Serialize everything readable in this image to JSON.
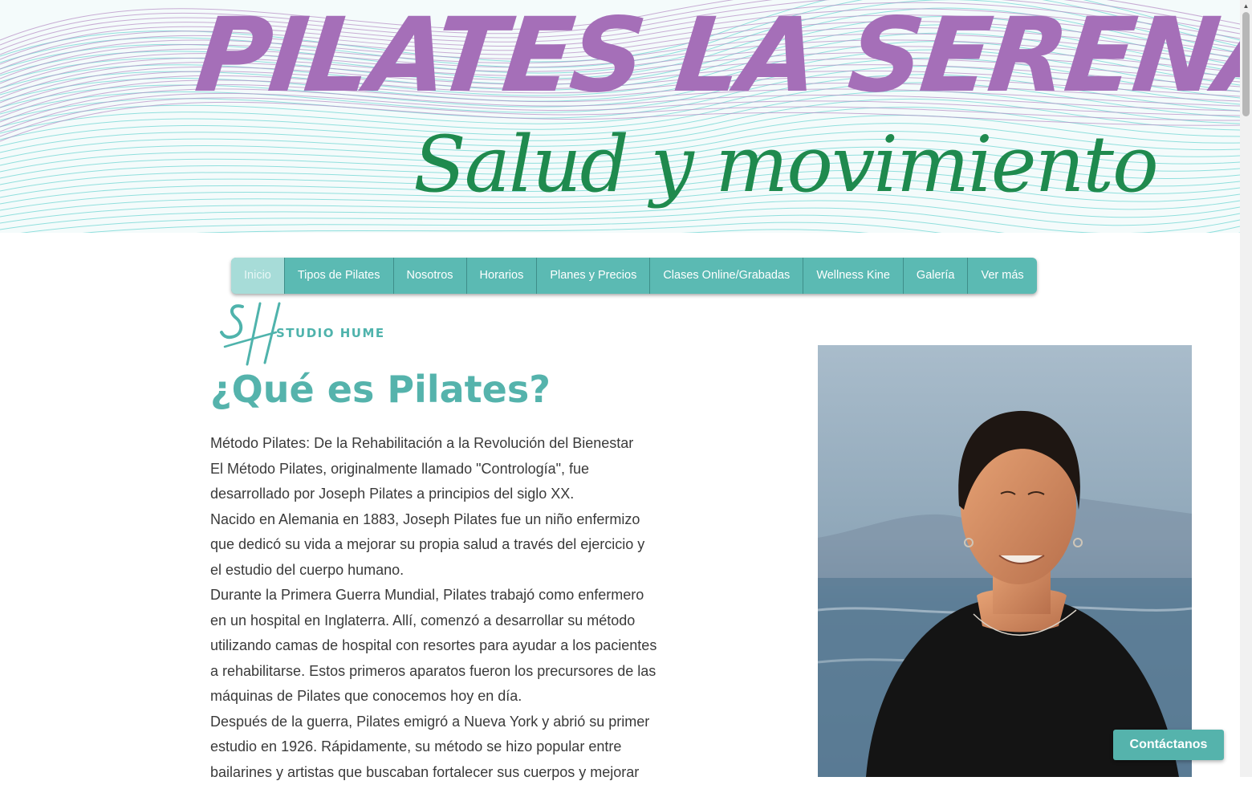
{
  "banner": {
    "title": "PILATES LA SERENA",
    "subtitle": "Salud y movimiento"
  },
  "nav": {
    "items": [
      {
        "label": "Inicio",
        "active": true
      },
      {
        "label": "Tipos de Pilates",
        "active": false
      },
      {
        "label": "Nosotros",
        "active": false
      },
      {
        "label": "Horarios",
        "active": false
      },
      {
        "label": "Planes y Precios",
        "active": false
      },
      {
        "label": "Clases Online/Grabadas",
        "active": false
      },
      {
        "label": "Wellness Kine",
        "active": false
      },
      {
        "label": "Galería",
        "active": false
      },
      {
        "label": "Ver más",
        "active": false
      }
    ]
  },
  "logo": {
    "text": "STUDIO HUME",
    "monogram": "SH"
  },
  "main": {
    "heading": "¿Qué es Pilates?",
    "paragraphs": [
      "Método Pilates: De la Rehabilitación a la Revolución del Bienestar",
      "El Método Pilates, originalmente llamado \"Contrología\", fue desarrollado por Joseph Pilates a principios del siglo XX.",
      "Nacido en Alemania en 1883, Joseph Pilates fue un niño enfermizo que dedicó su vida a mejorar su propia salud a través del ejercicio y el estudio del cuerpo humano.",
      "Durante la Primera Guerra Mundial, Pilates trabajó como enfermero en un hospital en Inglaterra. Allí, comenzó a desarrollar su método utilizando camas de hospital con resortes para ayudar a los pacientes a rehabilitarse. Estos primeros aparatos fueron los precursores de las máquinas de Pilates que conocemos hoy en día.",
      "Después de la guerra, Pilates emigró a Nueva York y abrió su primer estudio en 1926. Rápidamente, su método se hizo popular entre bailarines y artistas que buscaban fortalecer sus cuerpos y mejorar"
    ]
  },
  "contact": {
    "label": "Contáctanos"
  },
  "colors": {
    "brand_teal": "#5bbab3",
    "title_purple": "#a56fb8",
    "subtitle_green": "#1f8a4e",
    "heading_teal": "#55b3ac"
  }
}
